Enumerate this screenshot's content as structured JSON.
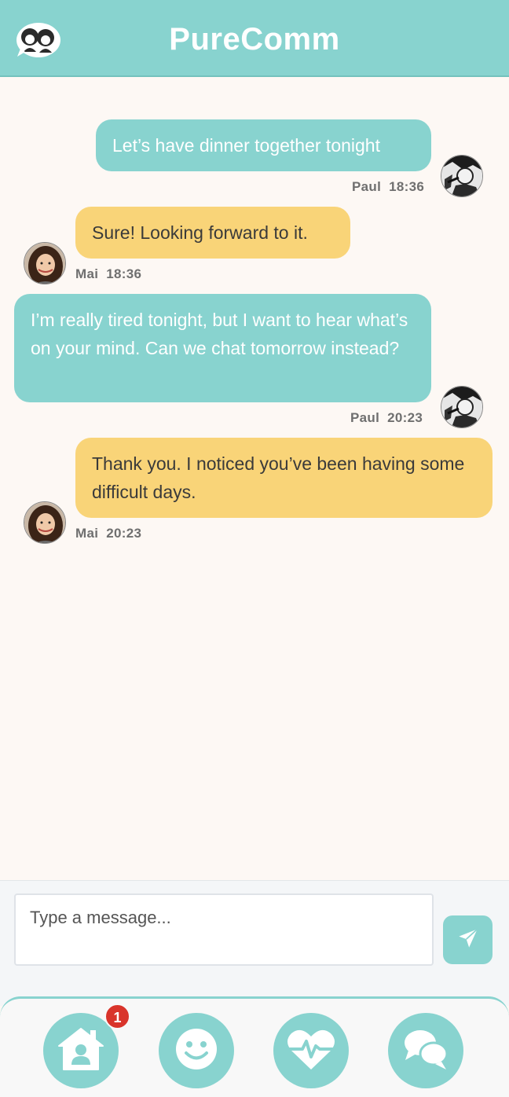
{
  "app": {
    "title": "PureComm",
    "accent_color": "#88d3cf",
    "mai_bubble_color": "#f9d478"
  },
  "messages": [
    {
      "sender": "Paul",
      "text": "Let’s have dinner together tonight",
      "time": "18:36"
    },
    {
      "sender": "Mai",
      "text": "Sure! Looking forward to it.",
      "time": "18:36"
    },
    {
      "sender": "Paul",
      "text": "I’m really tired tonight, but I want to hear what’s on your mind. Can we chat tomorrow instead?",
      "time": "20:23"
    },
    {
      "sender": "Mai",
      "text": "Thank you. I noticed you’ve been having some difficult days.",
      "time": "20:23"
    }
  ],
  "composer": {
    "placeholder": "Type a message...",
    "send_icon": "paper-plane-icon"
  },
  "nav": {
    "items": [
      {
        "icon": "home-user-icon",
        "badge": "1"
      },
      {
        "icon": "smiley-icon"
      },
      {
        "icon": "heartbeat-icon"
      },
      {
        "icon": "chat-bubbles-icon"
      }
    ],
    "badge_color": "#d9342b"
  }
}
